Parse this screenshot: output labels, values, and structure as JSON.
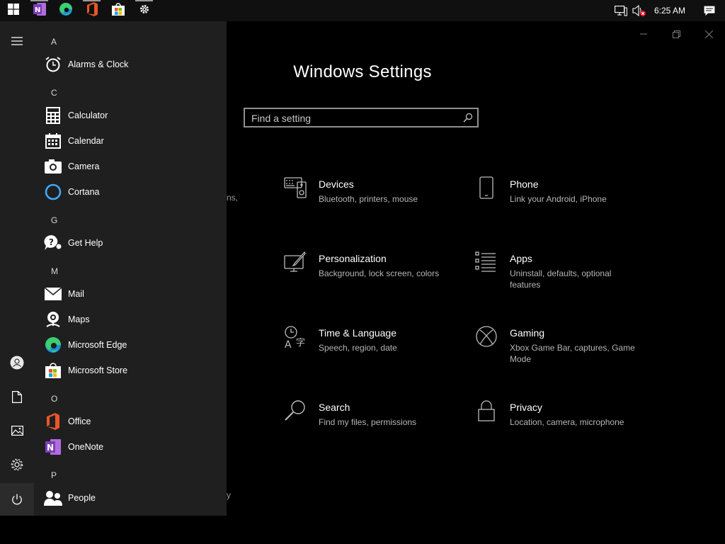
{
  "taskbar": {
    "pinned": [
      {
        "name": "start-button",
        "icon": "windows-logo-icon"
      },
      {
        "name": "taskbar-onenote",
        "icon": "onenote-icon"
      },
      {
        "name": "taskbar-edge",
        "icon": "edge-icon"
      },
      {
        "name": "taskbar-office",
        "icon": "office-icon"
      },
      {
        "name": "taskbar-store",
        "icon": "store-icon"
      },
      {
        "name": "taskbar-settings",
        "icon": "gear-icon"
      }
    ],
    "time": "6:25 AM",
    "tray_icons": [
      "network-icon",
      "volume-muted-icon",
      "notifications-icon"
    ]
  },
  "settings": {
    "title": "Windows Settings",
    "search_placeholder": "Find a setting",
    "partial_texts": [
      "ns,",
      "y"
    ],
    "tiles": [
      {
        "name": "Devices",
        "desc": "Bluetooth, printers, mouse",
        "icon": "devices-icon"
      },
      {
        "name": "Phone",
        "desc": "Link your Android, iPhone",
        "icon": "phone-icon"
      },
      {
        "name": "Personalization",
        "desc": "Background, lock screen, colors",
        "icon": "personalization-icon"
      },
      {
        "name": "Apps",
        "desc": "Uninstall, defaults, optional features",
        "icon": "apps-icon"
      },
      {
        "name": "Time & Language",
        "desc": "Speech, region, date",
        "icon": "time-language-icon"
      },
      {
        "name": "Gaming",
        "desc": "Xbox Game Bar, captures, Game Mode",
        "icon": "xbox-icon"
      },
      {
        "name": "Search",
        "desc": "Find my files, permissions",
        "icon": "search-icon"
      },
      {
        "name": "Privacy",
        "desc": "Location, camera, microphone",
        "icon": "lock-icon"
      }
    ],
    "window_controls": [
      "minimize-icon",
      "restore-icon",
      "close-icon"
    ]
  },
  "start_menu": {
    "rail": [
      "hamburger-icon",
      "user-icon",
      "documents-icon",
      "pictures-icon",
      "gear-icon",
      "power-icon"
    ],
    "sections": [
      {
        "letter": "A",
        "apps": [
          {
            "name": "Alarms & Clock",
            "icon": "alarm-clock-icon"
          }
        ]
      },
      {
        "letter": "C",
        "apps": [
          {
            "name": "Calculator",
            "icon": "calculator-icon"
          },
          {
            "name": "Calendar",
            "icon": "calendar-icon"
          },
          {
            "name": "Camera",
            "icon": "camera-icon"
          },
          {
            "name": "Cortana",
            "icon": "cortana-icon"
          }
        ]
      },
      {
        "letter": "G",
        "apps": [
          {
            "name": "Get Help",
            "icon": "get-help-icon"
          }
        ]
      },
      {
        "letter": "M",
        "apps": [
          {
            "name": "Mail",
            "icon": "mail-icon"
          },
          {
            "name": "Maps",
            "icon": "maps-icon"
          },
          {
            "name": "Microsoft Edge",
            "icon": "edge-icon"
          },
          {
            "name": "Microsoft Store",
            "icon": "store-icon"
          }
        ]
      },
      {
        "letter": "O",
        "apps": [
          {
            "name": "Office",
            "icon": "office-icon"
          },
          {
            "name": "OneNote",
            "icon": "onenote-icon"
          }
        ]
      },
      {
        "letter": "P",
        "apps": [
          {
            "name": "People",
            "icon": "people-icon"
          }
        ]
      }
    ]
  }
}
